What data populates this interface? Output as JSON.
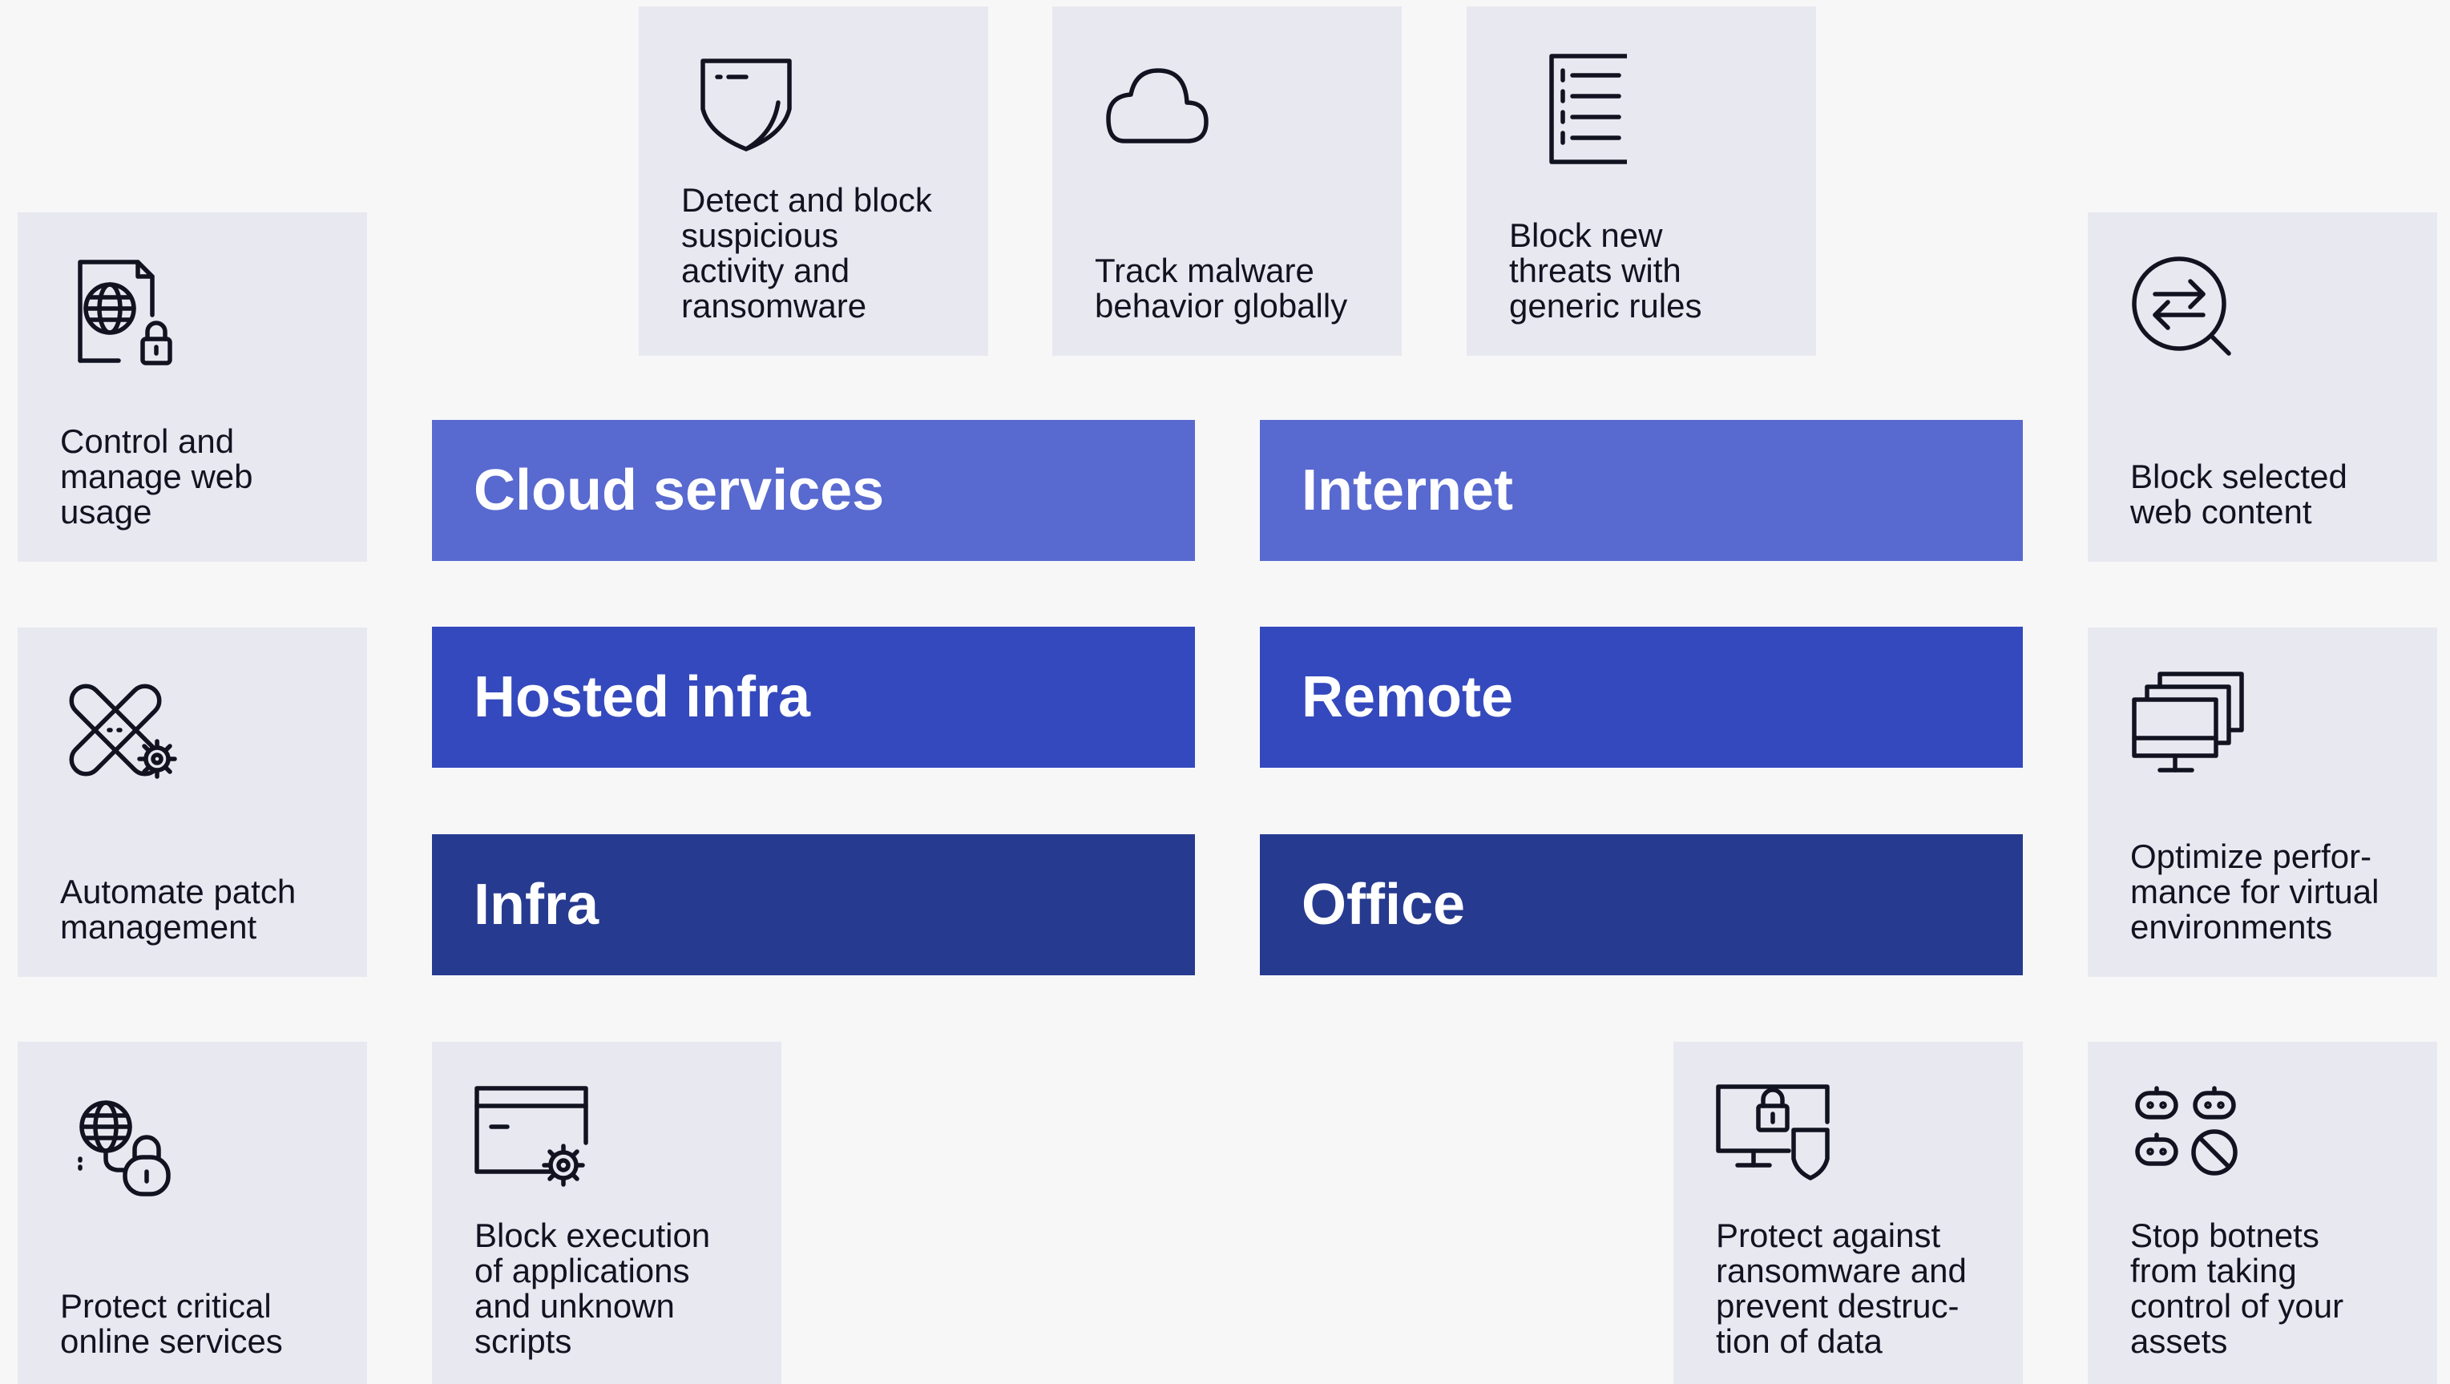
{
  "cards": {
    "detect": "Detect and block\nsuspicious\nactivity and\nransomware",
    "track": "Track malware\nbehavior globally",
    "rules": "Block new\nthreats with\ngeneric rules",
    "web_usage": "Control and\nmanage web\nusage",
    "web_content": "Block selected\nweb content",
    "patch": "Automate patch\nmanagement",
    "virtual": "Optimize perfor-\nmance for virtual\nenvironments",
    "online": "Protect critical\nonline services",
    "execution": "Block execution\nof applications\nand unknown\nscripts",
    "ransomware": "Protect against\nransomware and\nprevent destruc-\ntion of data",
    "botnets": "Stop botnets\nfrom taking\ncontrol of your\nassets"
  },
  "bands": {
    "cloud": "Cloud services",
    "internet": "Internet",
    "hosted": "Hosted infra",
    "remote": "Remote",
    "infra": "Infra",
    "office": "Office"
  },
  "colors": {
    "band_light": "#5869d0",
    "band_mid": "#3449bd",
    "band_dark": "#263a8f",
    "card_bg": "#e8e8f0"
  },
  "icons": {
    "detect": "shield-icon",
    "track": "cloud-icon",
    "rules": "checklist-icon",
    "web_usage": "web-lock-document-icon",
    "web_content": "search-exchange-icon",
    "patch": "bandage-gear-icon",
    "virtual": "multiple-monitors-icon",
    "online": "globe-lock-icon",
    "execution": "window-gear-icon",
    "ransomware": "monitor-lock-shield-icon",
    "botnets": "robots-blocked-icon"
  }
}
